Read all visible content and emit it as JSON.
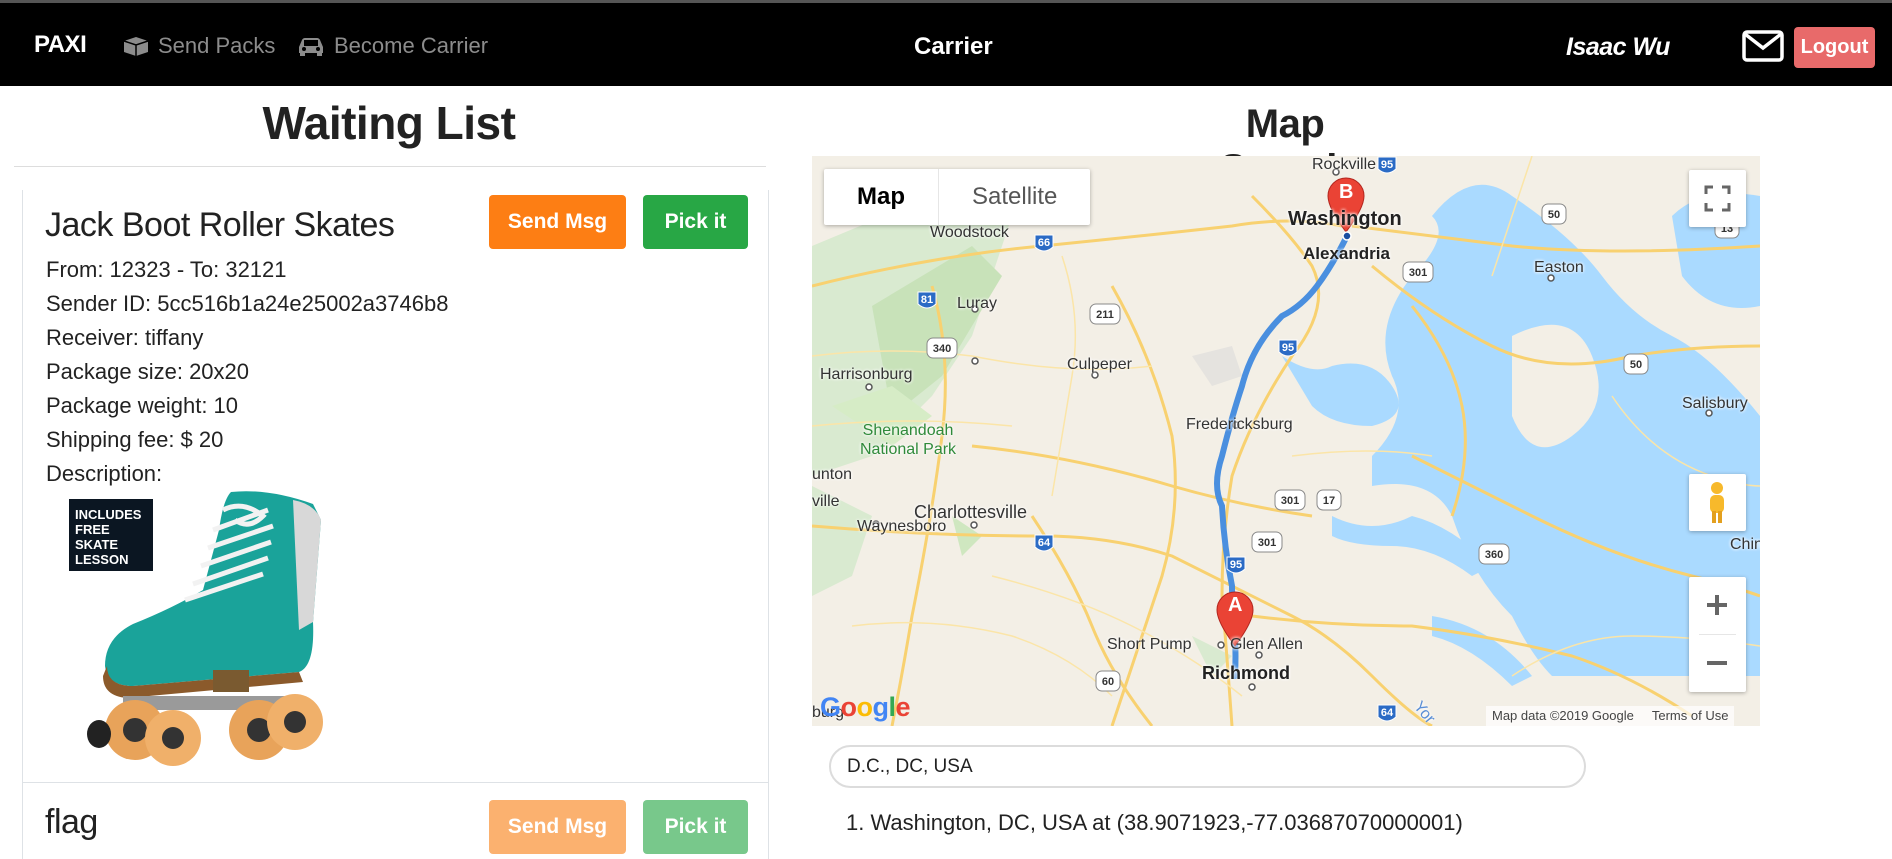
{
  "navbar": {
    "brand": "PAXI",
    "send_packs": "Send Packs",
    "become_carrier": "Become Carrier",
    "center_title": "Carrier",
    "user_name": "Isaac Wu",
    "logout_label": "Logout",
    "icons": [
      "box-icon",
      "car-icon",
      "mail-icon"
    ]
  },
  "waiting_list": {
    "title": "Waiting List",
    "send_msg_label": "Send Msg",
    "pick_label": "Pick it",
    "items": [
      {
        "name": "Jack Boot Roller Skates",
        "route": "From: 12323 - To: 32121",
        "sender": "Sender ID: 5cc516b1a24e25002a3746b8",
        "receiver": "Receiver: tiffany",
        "size": "Package size: 20x20",
        "weight": "Package weight: 10",
        "fee": "Shipping fee: $ 20",
        "description": "Description:",
        "image_badge": [
          "INCLUDES",
          "FREE",
          "SKATE",
          "LESSON"
        ]
      },
      {
        "name": "flag"
      }
    ]
  },
  "map_search": {
    "title": "Map Search",
    "map_type_map": "Map",
    "map_type_satellite": "Satellite",
    "marker_a": "A",
    "marker_b": "B",
    "attribution_data": "Map data ©2019 Google",
    "attribution_terms": "Terms of Use",
    "google_logo": "Google",
    "labels": {
      "rockville": "Rockville",
      "washington": "Washington",
      "alexandria": "Alexandria",
      "woodstock": "Woodstock",
      "luray": "Luray",
      "culpeper": "Culpeper",
      "harrisonburg": "Harrisonburg",
      "shenandoah": "Shenandoah",
      "national_park": "National Park",
      "fredericksburg": "Fredericksburg",
      "charlottesville": "Charlottesville",
      "waynesboro": "Waynesboro",
      "unton": "unton",
      "ville": "ville",
      "short_pump": "Short Pump",
      "glen_allen": "Glen Allen",
      "richmond": "Richmond",
      "easton": "Easton",
      "salisbury": "Salisbury",
      "chin": "Chin",
      "burg": "burg",
      "york": "Yor"
    },
    "shields": {
      "i95_top": "95",
      "i95_mid": "95",
      "i95_bottom": "95",
      "i66": "66",
      "i81": "81",
      "i64_left": "64",
      "i64_bottom": "64",
      "r50_top": "50",
      "r50_right": "50",
      "r13": "13",
      "r301_top": "301",
      "r301_mid": "301",
      "r301_bottom": "301",
      "r17": "17",
      "r211": "211",
      "r340": "340",
      "r360": "360",
      "r60": "60"
    },
    "search_value": "D.C., DC, USA",
    "result": "1. Washington, DC, USA at (38.9071923,-77.03687070000001)"
  }
}
